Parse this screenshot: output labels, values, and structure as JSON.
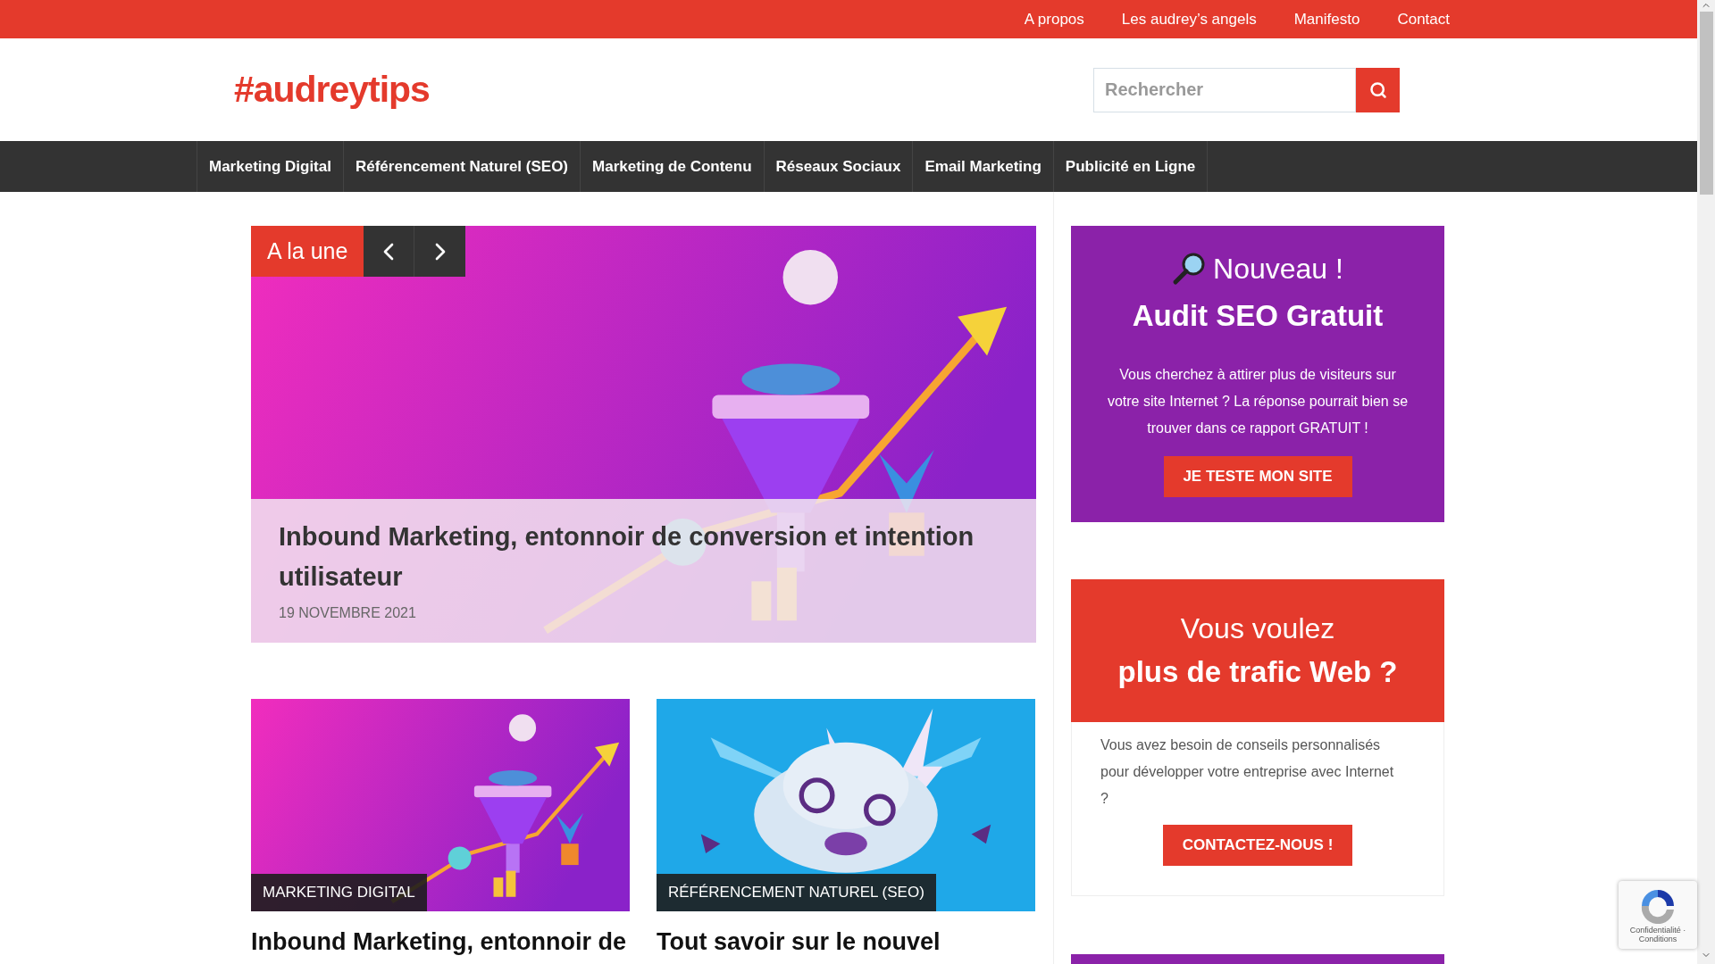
{
  "top_links": [
    "A propos",
    "Les audrey’s angels",
    "Manifesto",
    "Contact"
  ],
  "logo": "#audreytips",
  "search": {
    "placeholder": "Rechercher"
  },
  "nav": [
    "Marketing Digital",
    "Référencement Naturel (SEO)",
    "Marketing de Contenu",
    "Réseaux Sociaux",
    "Email Marketing",
    "Publicité en Ligne"
  ],
  "featured": {
    "label": "A la une",
    "title": "Inbound Marketing, entonnoir de conversion et intention utilisateur",
    "date": "19 NOVEMBRE 2021"
  },
  "cards": [
    {
      "category": "MARKETING DIGITAL",
      "title": "Inbound Marketing, entonnoir de"
    },
    {
      "category": "RÉFÉRENCEMENT NATUREL (SEO)",
      "title": "Tout savoir sur le nouvel"
    }
  ],
  "audit_box": {
    "kicker": "Nouveau !",
    "title": "Audit SEO Gratuit",
    "text": "Vous cherchez à attirer plus de visiteurs sur votre site Internet ? La réponse pourrait bien se trouver dans ce rapport GRATUIT !",
    "button": "JE TESTE MON SITE"
  },
  "traffic_box": {
    "line_1": "Vous voulez",
    "line_2": "plus de trafic Web ?",
    "text": "Vous avez besoin de conseils personnalisés pour développer votre entreprise avec Internet ?",
    "button": "CONTACTEZ-NOUS !"
  },
  "recaptcha": {
    "text": "Confidentialité · Conditions"
  }
}
